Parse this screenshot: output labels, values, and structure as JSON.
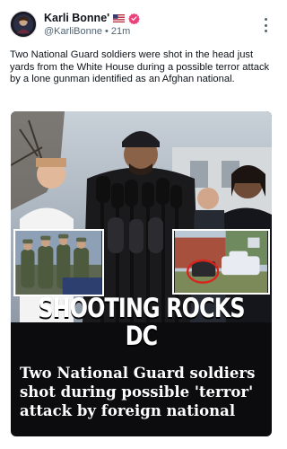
{
  "post": {
    "author": {
      "name": "Karli Bonne'",
      "handle": "@KarliBonne",
      "separator": "•",
      "time": "21m",
      "avatar_icon": "profile-avatar",
      "flag_icon": "us-flag-icon",
      "verified_icon": "verified-badge-icon",
      "verified_color": "#e8437a"
    },
    "menu_icon": "more-options-icon",
    "text": "Two National Guard soldiers were shot in the head just yards from the White House during a possible terror attack by a lone gunman identified as an Afghan national.",
    "media": {
      "headline": "SHOOTING ROCKS DC",
      "subheadline": "Two National Guard soldiers shot during possible 'terror' attack by foreign national"
    }
  }
}
